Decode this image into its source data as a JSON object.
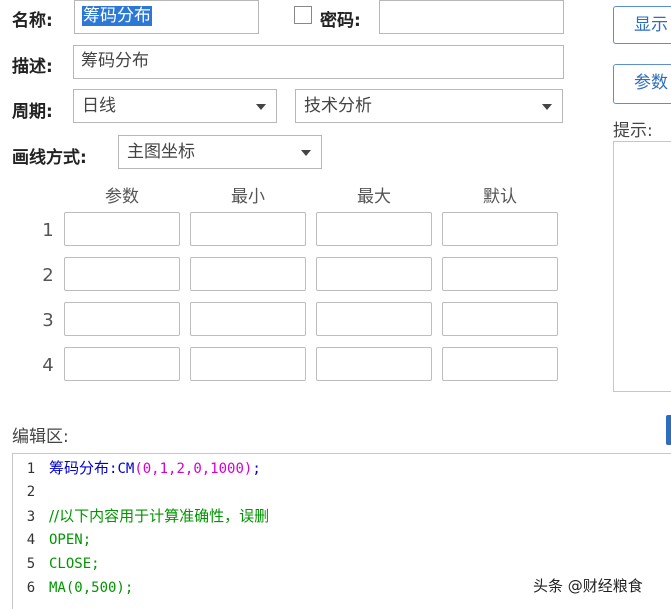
{
  "form": {
    "name_label": "名称:",
    "name_value": "筹码分布",
    "password_label": "密码:",
    "password_value": "",
    "desc_label": "描述:",
    "desc_value": "筹码分布",
    "period_label": "周期:",
    "period_value": "日线",
    "category_value": "技术分析",
    "draw_label": "画线方式:",
    "draw_value": "主图坐标"
  },
  "params": {
    "headers": [
      "参数",
      "最小",
      "最大",
      "默认"
    ],
    "rows": [
      "1",
      "2",
      "3",
      "4"
    ]
  },
  "side": {
    "show_button": "显示",
    "param_button": "参数",
    "hint_label": "提示:"
  },
  "editor": {
    "label": "编辑区:",
    "lines": [
      {
        "num": "1",
        "name": "筹码分布",
        "sep": ":",
        "fn": "CM",
        "args": "(0,1,2,0,1000)",
        "end": ";"
      },
      {
        "num": "2",
        "text": ""
      },
      {
        "num": "3",
        "comment": "//以下内容用于计算准确性，误删"
      },
      {
        "num": "4",
        "code": "OPEN;"
      },
      {
        "num": "5",
        "code": "CLOSE;"
      },
      {
        "num": "6",
        "fn": "MA",
        "args": "(0,500)",
        "end": ";"
      }
    ]
  },
  "watermark": "头条 @财经粮食"
}
